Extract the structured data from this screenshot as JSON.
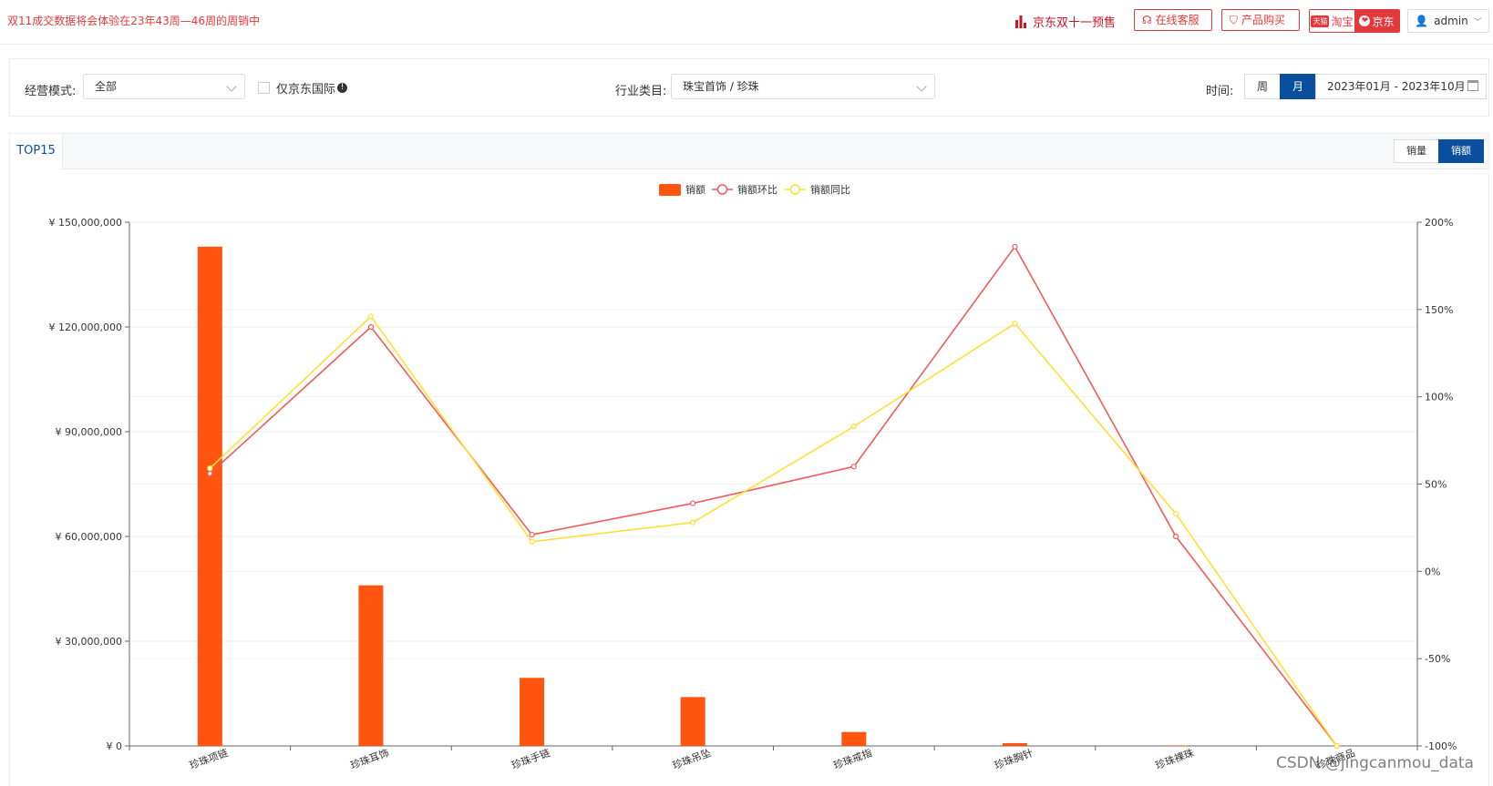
{
  "topbar": {
    "notice": "双11成交数据将会体验在23年43周—46周的周销中",
    "jd_presale": "京东双十一预售",
    "online_service": "在线客服",
    "product_buy": "产品购买",
    "platform_taobao": "淘宝",
    "platform_tmall_badge": "天猫",
    "platform_jd": "京东",
    "user": "admin"
  },
  "filters": {
    "mode_label": "经营模式:",
    "mode_value": "全部",
    "jd_intl_label": "仅京东国际",
    "industry_label": "行业类目:",
    "industry_value": "珠宝首饰 / 珍珠",
    "time_label": "时间:",
    "time_week": "周",
    "time_month": "月",
    "time_range": "2023年01月 - 2023年10月"
  },
  "panel": {
    "tab": "TOP15",
    "toggle_volume": "销量",
    "toggle_amount": "销额"
  },
  "watermark": "CSDN @jingcanmou_data",
  "colors": {
    "bar": "#ff5511",
    "mom": "#f25a5a",
    "yoy": "#ffe033",
    "primary": "#0a4f9e",
    "accent": "#e4393c"
  },
  "chart_data": {
    "type": "bar",
    "categories": [
      "珍珠项链",
      "珍珠耳饰",
      "珍珠手链",
      "珍珠吊坠",
      "珍珠戒指",
      "珍珠胸针",
      "珍珠裸珠",
      "珍珠商品"
    ],
    "legend": [
      "销额",
      "销额环比",
      "销额同比"
    ],
    "legend_position": "top-center",
    "series": [
      {
        "name": "销额",
        "type": "bar",
        "axis": "left",
        "values": [
          143000000,
          46000000,
          19500000,
          14000000,
          4000000,
          800000,
          150000,
          0
        ]
      },
      {
        "name": "销额环比",
        "type": "line",
        "axis": "right",
        "values": [
          56,
          140,
          21,
          39,
          60,
          186,
          20,
          -100
        ]
      },
      {
        "name": "销额同比",
        "type": "line",
        "axis": "right",
        "values": [
          59,
          146,
          17,
          28,
          83,
          142,
          33,
          -100
        ]
      }
    ],
    "y_left": {
      "min": 0,
      "max": 150000000,
      "ticks": [
        0,
        30000000,
        60000000,
        90000000,
        120000000,
        150000000
      ],
      "tick_labels": [
        "¥ 0",
        "¥ 30,000,000",
        "¥ 60,000,000",
        "¥ 90,000,000",
        "¥ 120,000,000",
        "¥ 150,000,000"
      ]
    },
    "y_right": {
      "min": -100,
      "max": 200,
      "ticks": [
        -100,
        -50,
        0,
        50,
        100,
        150,
        200
      ],
      "tick_labels": [
        "-100%",
        "-50%",
        "0%",
        "50%",
        "100%",
        "150%",
        "200%"
      ]
    },
    "grid": true
  }
}
